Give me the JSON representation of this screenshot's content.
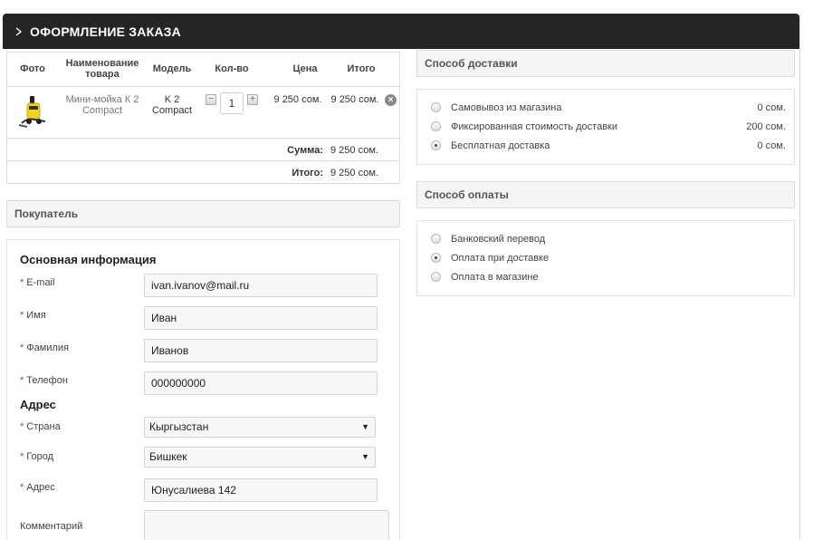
{
  "header": {
    "title": "ОФОРМЛЕНИЕ ЗАКАЗА"
  },
  "cart": {
    "columns": [
      "Фото",
      "Наименование товара",
      "Модель",
      "Кол-во",
      "Цена",
      "Итого"
    ],
    "items": [
      {
        "name": "Мини-мойка К 2 Compact",
        "model": "K 2 Compact",
        "qty": "1",
        "price": "9 250 сом.",
        "total": "9 250 сом."
      }
    ],
    "sum_label": "Сумма:",
    "sum_value": "9 250 сом.",
    "total_label": "Итого:",
    "total_value": "9 250 сом."
  },
  "buyer": {
    "section_title": "Покупатель",
    "basic_title": "Основная информация",
    "address_title": "Адрес",
    "fields": {
      "email": {
        "label": "E-mail",
        "value": "ivan.ivanov@mail.ru"
      },
      "first_name": {
        "label": "Имя",
        "value": "Иван"
      },
      "last_name": {
        "label": "Фамилия",
        "value": "Иванов"
      },
      "phone": {
        "label": "Телефон",
        "value": "000000000"
      },
      "country": {
        "label": "Страна",
        "value": "Кыргызстан"
      },
      "city": {
        "label": "Город",
        "value": "Бишкек"
      },
      "address": {
        "label": "Адрес",
        "value": "Юнусалиева 142"
      },
      "comment": {
        "label": "Комментарий",
        "value": ""
      }
    },
    "required_mark": "*"
  },
  "delivery": {
    "title": "Способ доставки",
    "options": [
      {
        "label": "Самовывоз из магазина",
        "price": "0 сом.",
        "selected": false
      },
      {
        "label": "Фиксированная стоимость доставки",
        "price": "200 сом.",
        "selected": false
      },
      {
        "label": "Бесплатная доставка",
        "price": "0 сом.",
        "selected": true
      }
    ]
  },
  "payment": {
    "title": "Способ оплаты",
    "options": [
      {
        "label": "Банковский перевод",
        "selected": false
      },
      {
        "label": "Оплата при доставке",
        "selected": true
      },
      {
        "label": "Оплата в магазине",
        "selected": false
      }
    ]
  },
  "icons": {
    "remove": "remove-icon",
    "minus": "minus-icon",
    "plus": "plus-icon",
    "select_arrow": "chevron-down-icon"
  },
  "colors": {
    "header_bg": "#252525",
    "required": "#c0392b"
  }
}
